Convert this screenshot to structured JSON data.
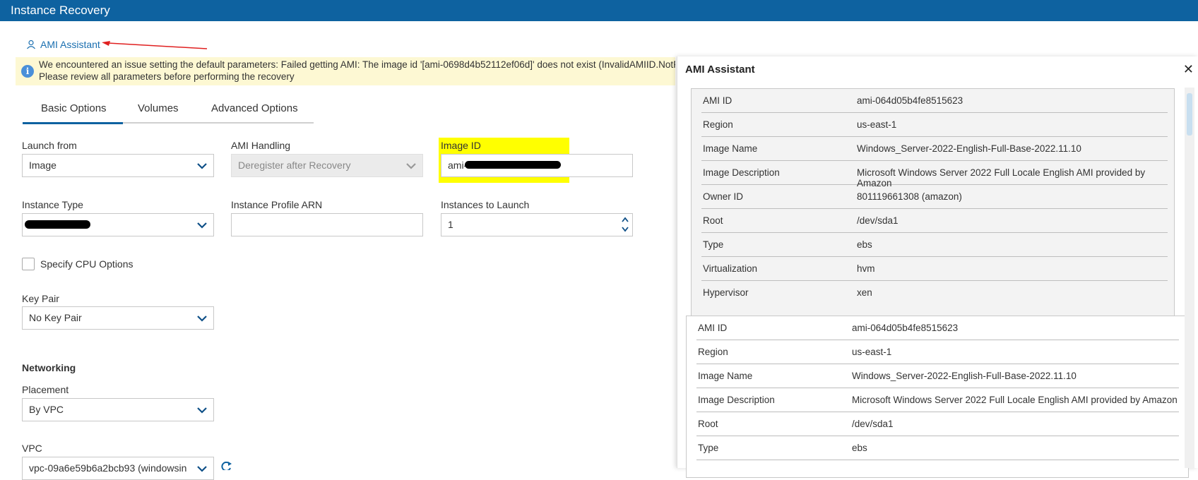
{
  "window": {
    "title": "Instance Recovery"
  },
  "assistant_link": {
    "label": "AMI Assistant"
  },
  "warning": {
    "line1": "We encountered an issue setting the default parameters: Failed getting AMI: The image id '[ami-0698d4b52112ef06d]' does not exist (InvalidAMIID.NotFound)",
    "line2": "Please review all parameters before performing the recovery"
  },
  "tabs": [
    {
      "label": "Basic Options"
    },
    {
      "label": "Volumes"
    },
    {
      "label": "Advanced Options"
    }
  ],
  "form": {
    "launch_from": {
      "label": "Launch from",
      "value": "Image"
    },
    "ami_handling": {
      "label": "AMI Handling",
      "value": "Deregister after Recovery"
    },
    "image_id": {
      "label": "Image ID",
      "value": "ami-"
    },
    "instance_type": {
      "label": "Instance Type",
      "value": ""
    },
    "instance_profile_arn": {
      "label": "Instance Profile ARN",
      "value": ""
    },
    "instances_to_launch": {
      "label": "Instances to Launch",
      "value": "1"
    },
    "specify_cpu": {
      "label": "Specify CPU Options"
    },
    "key_pair": {
      "label": "Key Pair",
      "value": "No Key Pair"
    },
    "networking": {
      "heading": "Networking"
    },
    "placement": {
      "label": "Placement",
      "value": "By VPC"
    },
    "vpc": {
      "label": "VPC",
      "value": "vpc-09a6e59b6a2bcb93 (windowsin"
    }
  },
  "panel": {
    "title": "AMI Assistant",
    "card1": [
      {
        "key": "AMI ID",
        "value": "ami-064d05b4fe8515623"
      },
      {
        "key": "Region",
        "value": "us-east-1"
      },
      {
        "key": "Image Name",
        "value": "Windows_Server-2022-English-Full-Base-2022.11.10"
      },
      {
        "key": "Image Description",
        "value": "Microsoft Windows Server 2022 Full Locale English AMI provided by Amazon"
      },
      {
        "key": "Owner ID",
        "value": "801119661308 (amazon)"
      },
      {
        "key": "Root",
        "value": "/dev/sda1"
      },
      {
        "key": "Type",
        "value": "ebs"
      },
      {
        "key": "Virtualization",
        "value": "hvm"
      },
      {
        "key": "Hypervisor",
        "value": "xen"
      }
    ],
    "card2": [
      {
        "key": "AMI ID",
        "value": "ami-064d05b4fe8515623"
      },
      {
        "key": "Region",
        "value": "us-east-1"
      },
      {
        "key": "Image Name",
        "value": "Windows_Server-2022-English-Full-Base-2022.11.10"
      },
      {
        "key": "Image Description",
        "value": "Microsoft Windows Server 2022 Full Locale English AMI provided by Amazon"
      },
      {
        "key": "Root",
        "value": "/dev/sda1"
      },
      {
        "key": "Type",
        "value": "ebs"
      }
    ]
  },
  "colors": {
    "header": "#0e62a0",
    "link": "#1a6fb0",
    "warning_bg": "#fdf8d3",
    "highlight": "#ffff00",
    "annotation_arrow": "#e02020"
  }
}
